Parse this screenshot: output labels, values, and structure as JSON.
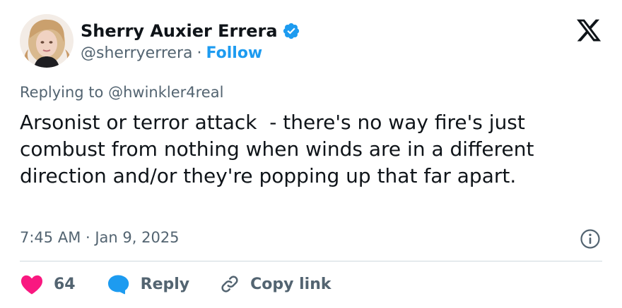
{
  "author": {
    "display_name": "Sherry Auxier Errera",
    "handle": "@sherryerrera",
    "separator": "·",
    "follow_label": "Follow"
  },
  "reply_context": {
    "prefix": "Replying to",
    "handle": "@hwinkler4real"
  },
  "tweet": {
    "text": "Arsonist or terror attack  - there's no way fire's just combust from nothing when winds are in a different direction and/or they're popping up that far apart.",
    "timestamp": "7:45 AM · Jan 9, 2025"
  },
  "actions": {
    "like_count": "64",
    "reply_label": "Reply",
    "copy_link_label": "Copy link"
  },
  "colors": {
    "accent": "#1d9bf0",
    "like": "#f91880",
    "secondary_text": "#536471",
    "primary_text": "#0f1419",
    "divider": "#cfd9de"
  },
  "icons": {
    "verified": "verified-badge-icon",
    "platform": "x-logo-icon",
    "info": "info-icon",
    "like": "heart-icon",
    "reply": "speech-bubble-icon",
    "copy_link": "link-icon"
  }
}
